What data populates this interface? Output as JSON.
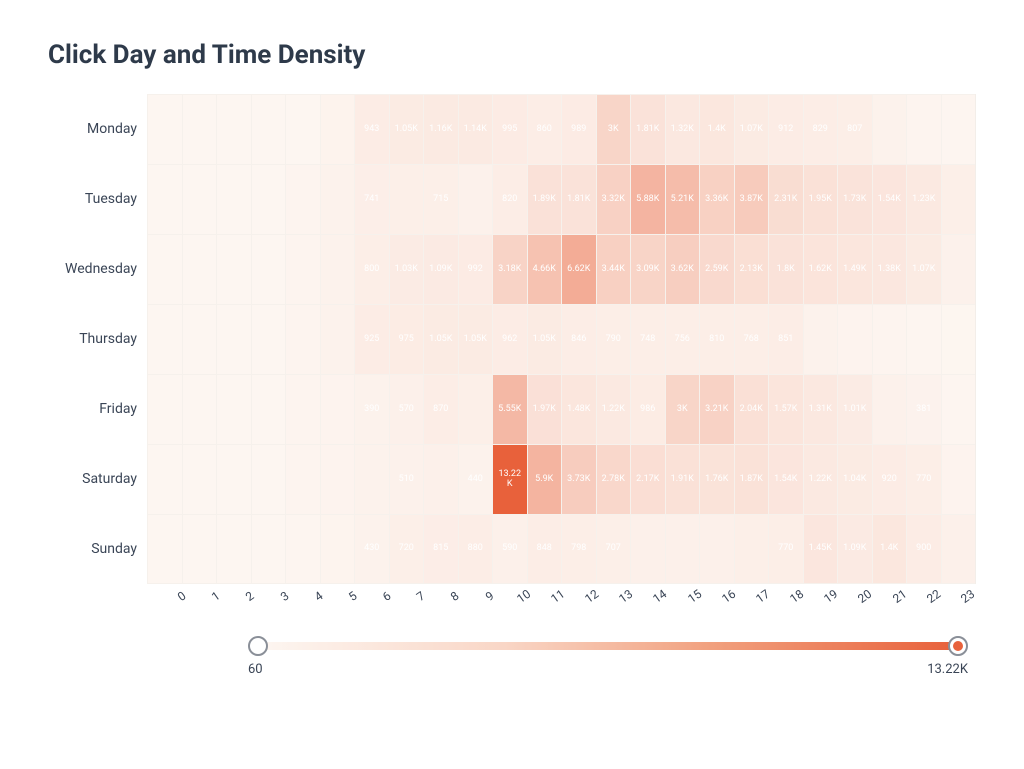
{
  "title": "Click Day and Time Density",
  "legend": {
    "min_label": "60",
    "max_label": "13.22K"
  },
  "chart_data": {
    "type": "heatmap",
    "xlabel": "",
    "ylabel": "",
    "x_categories": [
      "0",
      "1",
      "2",
      "3",
      "4",
      "5",
      "6",
      "7",
      "8",
      "9",
      "10",
      "11",
      "12",
      "13",
      "14",
      "15",
      "16",
      "17",
      "18",
      "19",
      "20",
      "21",
      "22",
      "23"
    ],
    "y_categories": [
      "Monday",
      "Tuesday",
      "Wednesday",
      "Thursday",
      "Friday",
      "Saturday",
      "Sunday"
    ],
    "zmin": 60,
    "zmax": 13220,
    "colorscale": [
      "#fdf6f1",
      "#e8613b"
    ],
    "values": [
      [
        60,
        60,
        60,
        60,
        60,
        350,
        943,
        1050,
        1160,
        1140,
        995,
        860,
        989,
        3000,
        1810,
        1320,
        1400,
        1070,
        912,
        829,
        807,
        420,
        200,
        120
      ],
      [
        60,
        60,
        60,
        60,
        200,
        400,
        741,
        700,
        715,
        510,
        820,
        1890,
        1810,
        3320,
        5880,
        5210,
        3360,
        3870,
        2310,
        1950,
        1730,
        1540,
        1230,
        720
      ],
      [
        60,
        60,
        60,
        60,
        200,
        400,
        800,
        1030,
        1090,
        992,
        3180,
        4660,
        6620,
        3440,
        3090,
        3620,
        2590,
        2130,
        1800,
        1620,
        1490,
        1380,
        1070,
        510
      ],
      [
        60,
        60,
        60,
        60,
        200,
        400,
        925,
        975,
        1050,
        1050,
        962,
        1050,
        846,
        790,
        748,
        756,
        810,
        768,
        851,
        420,
        300,
        200,
        150,
        100
      ],
      [
        60,
        60,
        60,
        60,
        200,
        300,
        390,
        570,
        870,
        700,
        5550,
        1970,
        1480,
        1220,
        986,
        3000,
        3210,
        2040,
        1570,
        1310,
        1010,
        530,
        381,
        150
      ],
      [
        60,
        60,
        60,
        60,
        200,
        300,
        400,
        510,
        600,
        440,
        13220,
        5900,
        3730,
        2780,
        2170,
        1910,
        1760,
        1870,
        1540,
        1220,
        1040,
        920,
        770,
        300
      ],
      [
        60,
        60,
        60,
        60,
        150,
        250,
        430,
        720,
        815,
        880,
        590,
        848,
        798,
        707,
        560,
        600,
        580,
        700,
        770,
        1450,
        1090,
        1400,
        900,
        550
      ]
    ],
    "labels": [
      [
        "",
        "",
        "",
        "",
        "",
        "",
        "943",
        "1.05K",
        "1.16K",
        "1.14K",
        "995",
        "860",
        "989",
        "3K",
        "1.81K",
        "1.32K",
        "1.4K",
        "1.07K",
        "912",
        "829",
        "807",
        "",
        "",
        ""
      ],
      [
        "",
        "",
        "",
        "",
        "",
        "",
        "741",
        "",
        "715",
        "",
        "820",
        "1.89K",
        "1.81K",
        "3.32K",
        "5.88K",
        "5.21K",
        "3.36K",
        "3.87K",
        "2.31K",
        "1.95K",
        "1.73K",
        "1.54K",
        "1.23K",
        ""
      ],
      [
        "",
        "",
        "",
        "",
        "",
        "",
        "800",
        "1.03K",
        "1.09K",
        "992",
        "3.18K",
        "4.66K",
        "6.62K",
        "3.44K",
        "3.09K",
        "3.62K",
        "2.59K",
        "2.13K",
        "1.8K",
        "1.62K",
        "1.49K",
        "1.38K",
        "1.07K",
        ""
      ],
      [
        "",
        "",
        "",
        "",
        "",
        "",
        "925",
        "975",
        "1.05K",
        "1.05K",
        "962",
        "1.05K",
        "846",
        "790",
        "748",
        "756",
        "810",
        "768",
        "851",
        "",
        "",
        "",
        "",
        ""
      ],
      [
        "",
        "",
        "",
        "",
        "",
        "",
        "390",
        "570",
        "870",
        "",
        "5.55K",
        "1.97K",
        "1.48K",
        "1.22K",
        "986",
        "3K",
        "3.21K",
        "2.04K",
        "1.57K",
        "1.31K",
        "1.01K",
        "",
        "381",
        ""
      ],
      [
        "",
        "",
        "",
        "",
        "",
        "",
        "",
        "510",
        "",
        "440",
        "13.22K",
        "5.9K",
        "3.73K",
        "2.78K",
        "2.17K",
        "1.91K",
        "1.76K",
        "1.87K",
        "1.54K",
        "1.22K",
        "1.04K",
        "920",
        "770",
        ""
      ],
      [
        "",
        "",
        "",
        "",
        "",
        "",
        "430",
        "720",
        "815",
        "880",
        "590",
        "848",
        "798",
        "707",
        "",
        "",
        "",
        "",
        "770",
        "1.45K",
        "1.09K",
        "1.4K",
        "900",
        ""
      ]
    ]
  }
}
